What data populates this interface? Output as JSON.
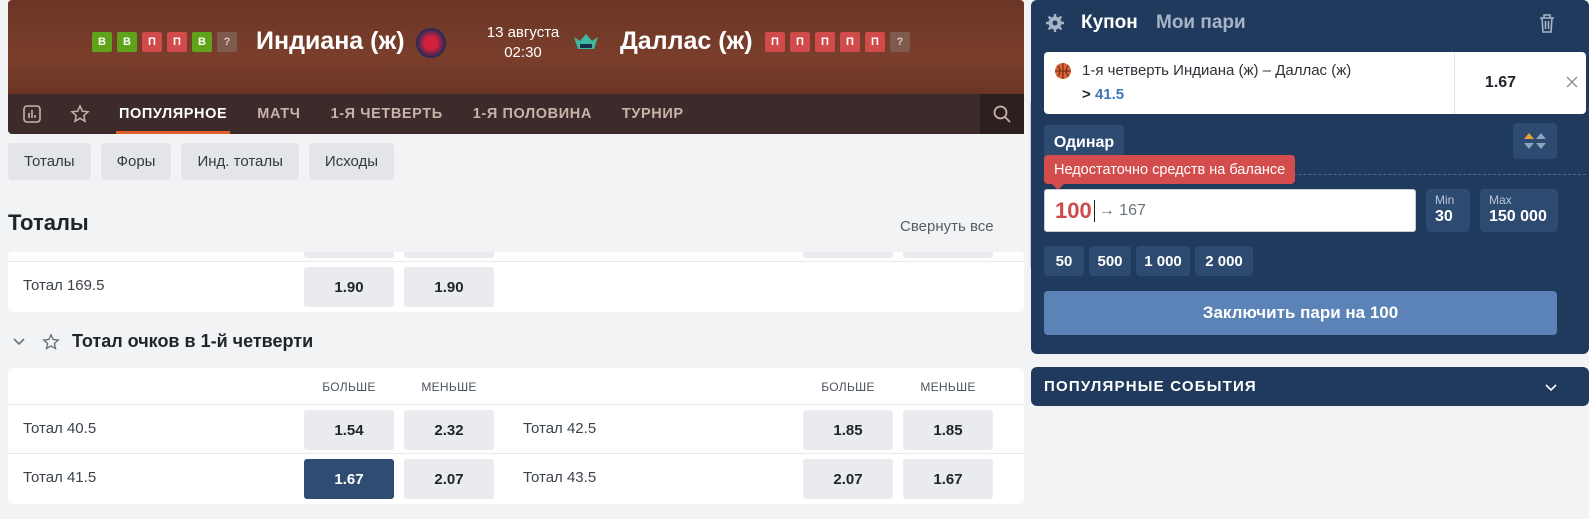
{
  "match": {
    "home_form": [
      "В",
      "В",
      "П",
      "П",
      "В",
      "?"
    ],
    "home_team": "Индиана (ж)",
    "date": "13 августа",
    "time": "02:30",
    "away_team": "Даллас (ж)",
    "away_form": [
      "П",
      "П",
      "П",
      "П",
      "П",
      "?"
    ]
  },
  "tabs": [
    "ПОПУЛЯРНОЕ",
    "МАТЧ",
    "1-Я ЧЕТВЕРТЬ",
    "1-Я ПОЛОВИНА",
    "ТУРНИР"
  ],
  "chips": [
    "Тоталы",
    "Форы",
    "Инд. тоталы",
    "Исходы"
  ],
  "section": {
    "title": "Тоталы",
    "collapse_all": "Свернуть все"
  },
  "totals_card": {
    "row_label": "Тотал 169.5",
    "over": "1.90",
    "under": "1.90"
  },
  "quarter_group": {
    "title": "Тотал очков в 1-й четверти",
    "over_head": "БОЛЬШЕ",
    "under_head": "МЕНЬШЕ",
    "rows": [
      {
        "left_label": "Тотал 40.5",
        "left_over": "1.54",
        "left_under": "2.32",
        "right_label": "Тотал 42.5",
        "right_over": "1.85",
        "right_under": "1.85"
      },
      {
        "left_label": "Тотал 41.5",
        "left_over": "1.67",
        "left_under": "2.07",
        "right_label": "Тотал 43.5",
        "right_over": "2.07",
        "right_under": "1.67"
      }
    ]
  },
  "coupon": {
    "title": "Купон",
    "my_bets": "Мои пари",
    "bet_name": "1-я четверть Индиана (ж) – Даллас (ж)",
    "bet_sel_prefix": ">",
    "bet_sel_value": "41.5",
    "bet_odd": "1.67",
    "mode": "Одинар",
    "error": "Недостаточно средств на балансе",
    "stake": "100",
    "potential_win": "→ 167",
    "min_label": "Min",
    "min_value": "30",
    "max_label": "Max",
    "max_value": "150 000",
    "quick_amounts": [
      "50",
      "500",
      "1 000",
      "2 000"
    ],
    "place_button": "Заключить пари на 100"
  },
  "popular_events": "ПОПУЛЯРНЫЕ СОБЫТИЯ",
  "colors": {
    "header_brown": "#6b3526",
    "coupon_navy": "#1f3a5c",
    "selected_odd": "#2f4d73",
    "error_red": "#d44d4d",
    "win_green": "#5ea31a",
    "loss_red": "#d14b4b"
  }
}
